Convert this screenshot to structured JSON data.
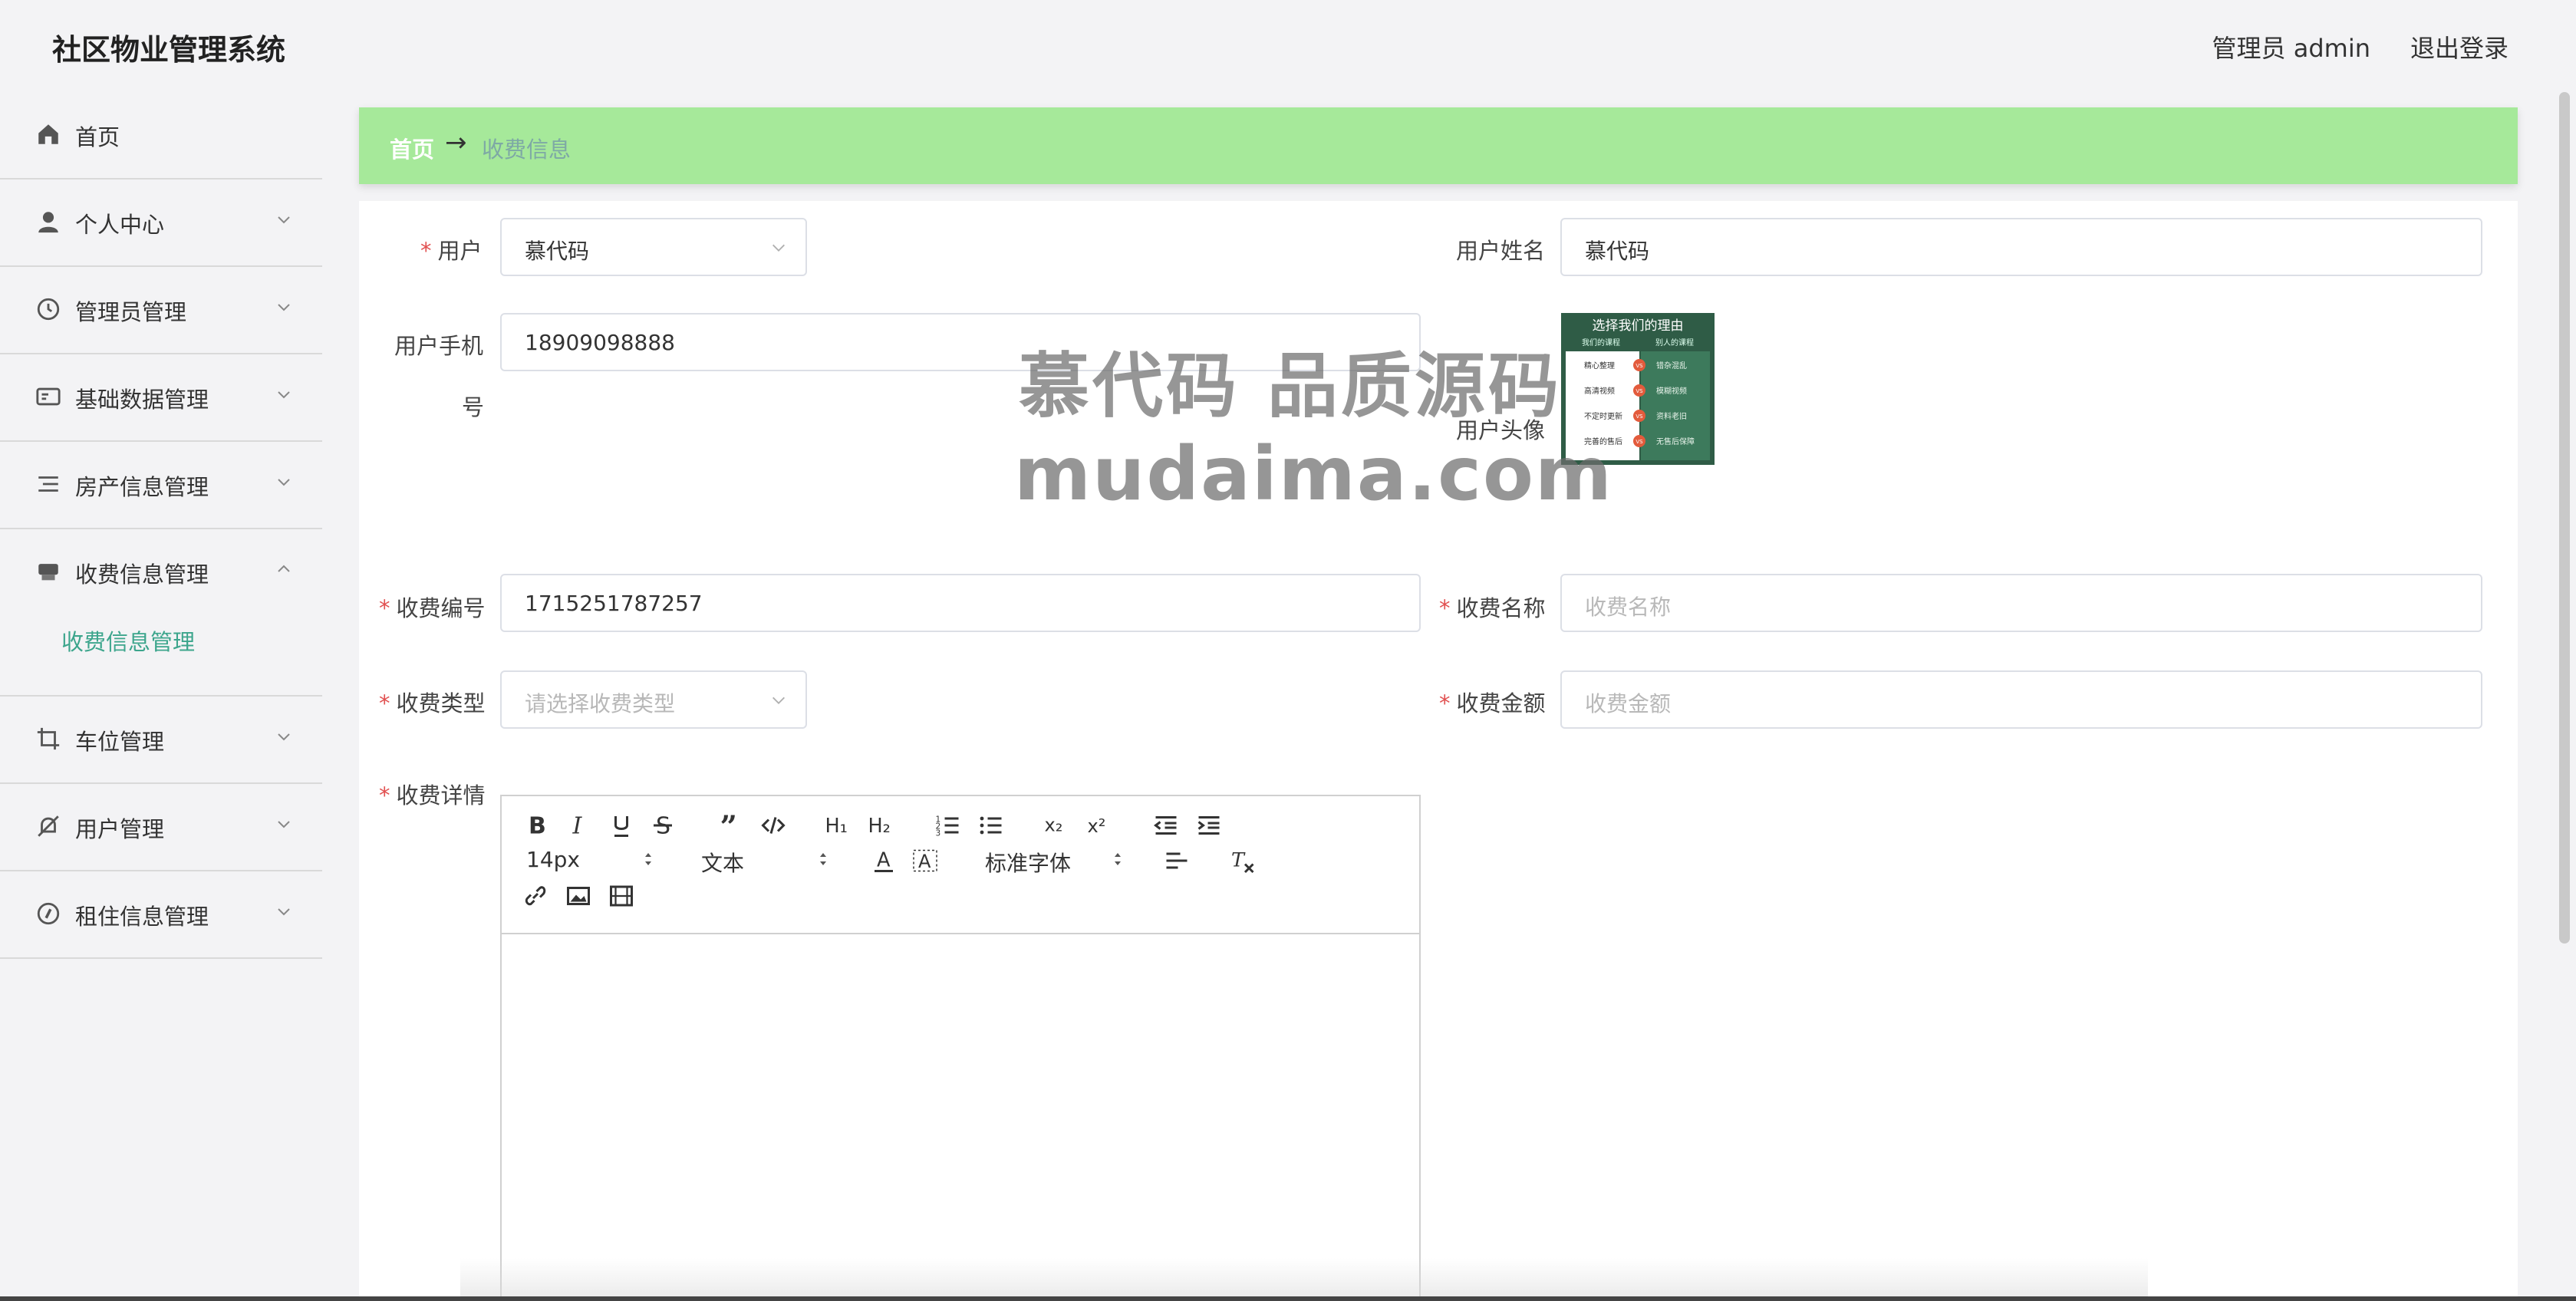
{
  "app": {
    "title": "社区物业管理系统",
    "admin": "管理员 admin",
    "logout": "退出登录"
  },
  "sidebar": {
    "items": [
      {
        "label": "首页",
        "icon": "home-icon"
      },
      {
        "label": "个人中心",
        "icon": "user-icon"
      },
      {
        "label": "管理员管理",
        "icon": "clock-icon"
      },
      {
        "label": "基础数据管理",
        "icon": "id-card-icon"
      },
      {
        "label": "房产信息管理",
        "icon": "list-icon"
      },
      {
        "label": "收费信息管理",
        "icon": "printer-icon"
      },
      {
        "label": "车位管理",
        "icon": "crop-icon"
      },
      {
        "label": "用户管理",
        "icon": "bell-off-icon"
      },
      {
        "label": "租住信息管理",
        "icon": "compass-icon"
      }
    ],
    "submenu_label": "收费信息管理"
  },
  "breadcrumb": {
    "home": "首页",
    "arrow": "→",
    "current": "收费信息"
  },
  "form": {
    "user_label": "用户",
    "user_value": "慕代码",
    "username_label": "用户姓名",
    "username_value": "慕代码",
    "phone_label_1": "用户手机",
    "phone_label_2": "号",
    "phone_value": "18909098888",
    "avatar_label": "用户头像",
    "fee_no_label": "收费编号",
    "fee_no_value": "1715251787257",
    "fee_name_label": "收费名称",
    "fee_name_placeholder": "收费名称",
    "fee_type_label": "收费类型",
    "fee_type_placeholder": "请选择收费类型",
    "fee_amount_label": "收费金额",
    "fee_amount_placeholder": "收费金额",
    "fee_detail_label": "收费详情",
    "required_mark": "*"
  },
  "avatar_image": {
    "title": "选择我们的理由",
    "col_left": "我们的课程",
    "col_right": "别人的课程",
    "rows_left": [
      "精心整理",
      "高清视频",
      "不定时更新",
      "完善的售后"
    ],
    "rows_right": [
      "错杂混乱",
      "模糊视频",
      "资料老旧",
      "无售后保障"
    ],
    "vs": "VS"
  },
  "editor": {
    "font_size": "14px",
    "text_type": "文本",
    "font_family": "标准字体"
  },
  "watermark": {
    "line1": "慕代码 品质源码",
    "line2": "mudaima.com"
  },
  "colors": {
    "accent": "#3ca58c",
    "breadcrumb_bg": "#a6e99a",
    "required": "#e15050"
  }
}
